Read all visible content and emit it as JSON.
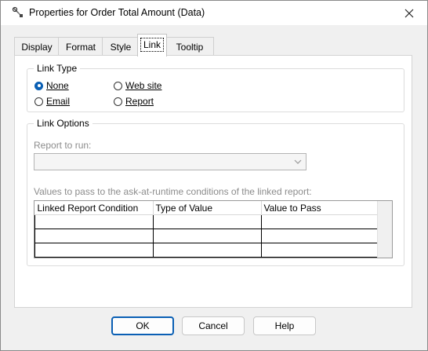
{
  "window": {
    "title": "Properties for Order Total Amount (Data)"
  },
  "tabs": [
    "Display",
    "Format",
    "Style",
    "Link",
    "Tooltip"
  ],
  "active_tab": "Link",
  "link_type": {
    "legend": "Link Type",
    "options": [
      {
        "label": "None",
        "checked": true
      },
      {
        "label": "Web site",
        "checked": false
      },
      {
        "label": "Email",
        "checked": false
      },
      {
        "label": "Report",
        "checked": false
      }
    ]
  },
  "link_options": {
    "legend": "Link Options",
    "report_label": "Report to run:",
    "report_value": "",
    "values_label": "Values to pass to the ask-at-runtime conditions of the linked report:",
    "columns": [
      "Linked Report Condition",
      "Type of Value",
      "Value to Pass"
    ]
  },
  "buttons": {
    "ok": "OK",
    "cancel": "Cancel",
    "help": "Help"
  },
  "colors": {
    "accent": "#0a5fb4"
  }
}
